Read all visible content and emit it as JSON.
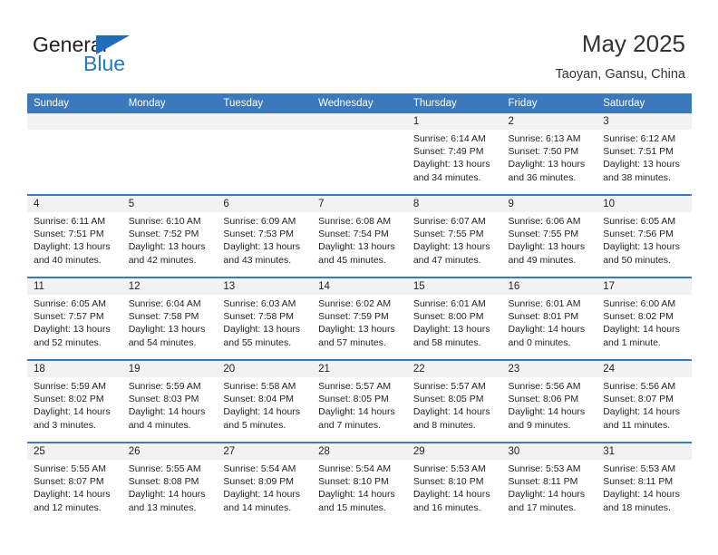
{
  "brand": {
    "name_top": "General",
    "name_bottom": "Blue",
    "flag_icon": "blue-triangle-flag",
    "accent_color": "#1f7ac4"
  },
  "header": {
    "title": "May 2025",
    "location": "Taoyan, Gansu, China"
  },
  "theme": {
    "header_blue": "#3b78bc",
    "daynum_band": "#f2f2f2",
    "text": "#231f20"
  },
  "calendar": {
    "weekday_headers": [
      "Sunday",
      "Monday",
      "Tuesday",
      "Wednesday",
      "Thursday",
      "Friday",
      "Saturday"
    ],
    "weeks": [
      [
        {
          "day": "",
          "empty": true
        },
        {
          "day": "",
          "empty": true
        },
        {
          "day": "",
          "empty": true
        },
        {
          "day": "",
          "empty": true
        },
        {
          "day": "1",
          "sunrise": "Sunrise: 6:14 AM",
          "sunset": "Sunset: 7:49 PM",
          "daylight": "Daylight: 13 hours and 34 minutes."
        },
        {
          "day": "2",
          "sunrise": "Sunrise: 6:13 AM",
          "sunset": "Sunset: 7:50 PM",
          "daylight": "Daylight: 13 hours and 36 minutes."
        },
        {
          "day": "3",
          "sunrise": "Sunrise: 6:12 AM",
          "sunset": "Sunset: 7:51 PM",
          "daylight": "Daylight: 13 hours and 38 minutes."
        }
      ],
      [
        {
          "day": "4",
          "sunrise": "Sunrise: 6:11 AM",
          "sunset": "Sunset: 7:51 PM",
          "daylight": "Daylight: 13 hours and 40 minutes."
        },
        {
          "day": "5",
          "sunrise": "Sunrise: 6:10 AM",
          "sunset": "Sunset: 7:52 PM",
          "daylight": "Daylight: 13 hours and 42 minutes."
        },
        {
          "day": "6",
          "sunrise": "Sunrise: 6:09 AM",
          "sunset": "Sunset: 7:53 PM",
          "daylight": "Daylight: 13 hours and 43 minutes."
        },
        {
          "day": "7",
          "sunrise": "Sunrise: 6:08 AM",
          "sunset": "Sunset: 7:54 PM",
          "daylight": "Daylight: 13 hours and 45 minutes."
        },
        {
          "day": "8",
          "sunrise": "Sunrise: 6:07 AM",
          "sunset": "Sunset: 7:55 PM",
          "daylight": "Daylight: 13 hours and 47 minutes."
        },
        {
          "day": "9",
          "sunrise": "Sunrise: 6:06 AM",
          "sunset": "Sunset: 7:55 PM",
          "daylight": "Daylight: 13 hours and 49 minutes."
        },
        {
          "day": "10",
          "sunrise": "Sunrise: 6:05 AM",
          "sunset": "Sunset: 7:56 PM",
          "daylight": "Daylight: 13 hours and 50 minutes."
        }
      ],
      [
        {
          "day": "11",
          "sunrise": "Sunrise: 6:05 AM",
          "sunset": "Sunset: 7:57 PM",
          "daylight": "Daylight: 13 hours and 52 minutes."
        },
        {
          "day": "12",
          "sunrise": "Sunrise: 6:04 AM",
          "sunset": "Sunset: 7:58 PM",
          "daylight": "Daylight: 13 hours and 54 minutes."
        },
        {
          "day": "13",
          "sunrise": "Sunrise: 6:03 AM",
          "sunset": "Sunset: 7:58 PM",
          "daylight": "Daylight: 13 hours and 55 minutes."
        },
        {
          "day": "14",
          "sunrise": "Sunrise: 6:02 AM",
          "sunset": "Sunset: 7:59 PM",
          "daylight": "Daylight: 13 hours and 57 minutes."
        },
        {
          "day": "15",
          "sunrise": "Sunrise: 6:01 AM",
          "sunset": "Sunset: 8:00 PM",
          "daylight": "Daylight: 13 hours and 58 minutes."
        },
        {
          "day": "16",
          "sunrise": "Sunrise: 6:01 AM",
          "sunset": "Sunset: 8:01 PM",
          "daylight": "Daylight: 14 hours and 0 minutes."
        },
        {
          "day": "17",
          "sunrise": "Sunrise: 6:00 AM",
          "sunset": "Sunset: 8:02 PM",
          "daylight": "Daylight: 14 hours and 1 minute."
        }
      ],
      [
        {
          "day": "18",
          "sunrise": "Sunrise: 5:59 AM",
          "sunset": "Sunset: 8:02 PM",
          "daylight": "Daylight: 14 hours and 3 minutes."
        },
        {
          "day": "19",
          "sunrise": "Sunrise: 5:59 AM",
          "sunset": "Sunset: 8:03 PM",
          "daylight": "Daylight: 14 hours and 4 minutes."
        },
        {
          "day": "20",
          "sunrise": "Sunrise: 5:58 AM",
          "sunset": "Sunset: 8:04 PM",
          "daylight": "Daylight: 14 hours and 5 minutes."
        },
        {
          "day": "21",
          "sunrise": "Sunrise: 5:57 AM",
          "sunset": "Sunset: 8:05 PM",
          "daylight": "Daylight: 14 hours and 7 minutes."
        },
        {
          "day": "22",
          "sunrise": "Sunrise: 5:57 AM",
          "sunset": "Sunset: 8:05 PM",
          "daylight": "Daylight: 14 hours and 8 minutes."
        },
        {
          "day": "23",
          "sunrise": "Sunrise: 5:56 AM",
          "sunset": "Sunset: 8:06 PM",
          "daylight": "Daylight: 14 hours and 9 minutes."
        },
        {
          "day": "24",
          "sunrise": "Sunrise: 5:56 AM",
          "sunset": "Sunset: 8:07 PM",
          "daylight": "Daylight: 14 hours and 11 minutes."
        }
      ],
      [
        {
          "day": "25",
          "sunrise": "Sunrise: 5:55 AM",
          "sunset": "Sunset: 8:07 PM",
          "daylight": "Daylight: 14 hours and 12 minutes."
        },
        {
          "day": "26",
          "sunrise": "Sunrise: 5:55 AM",
          "sunset": "Sunset: 8:08 PM",
          "daylight": "Daylight: 14 hours and 13 minutes."
        },
        {
          "day": "27",
          "sunrise": "Sunrise: 5:54 AM",
          "sunset": "Sunset: 8:09 PM",
          "daylight": "Daylight: 14 hours and 14 minutes."
        },
        {
          "day": "28",
          "sunrise": "Sunrise: 5:54 AM",
          "sunset": "Sunset: 8:10 PM",
          "daylight": "Daylight: 14 hours and 15 minutes."
        },
        {
          "day": "29",
          "sunrise": "Sunrise: 5:53 AM",
          "sunset": "Sunset: 8:10 PM",
          "daylight": "Daylight: 14 hours and 16 minutes."
        },
        {
          "day": "30",
          "sunrise": "Sunrise: 5:53 AM",
          "sunset": "Sunset: 8:11 PM",
          "daylight": "Daylight: 14 hours and 17 minutes."
        },
        {
          "day": "31",
          "sunrise": "Sunrise: 5:53 AM",
          "sunset": "Sunset: 8:11 PM",
          "daylight": "Daylight: 14 hours and 18 minutes."
        }
      ]
    ]
  }
}
